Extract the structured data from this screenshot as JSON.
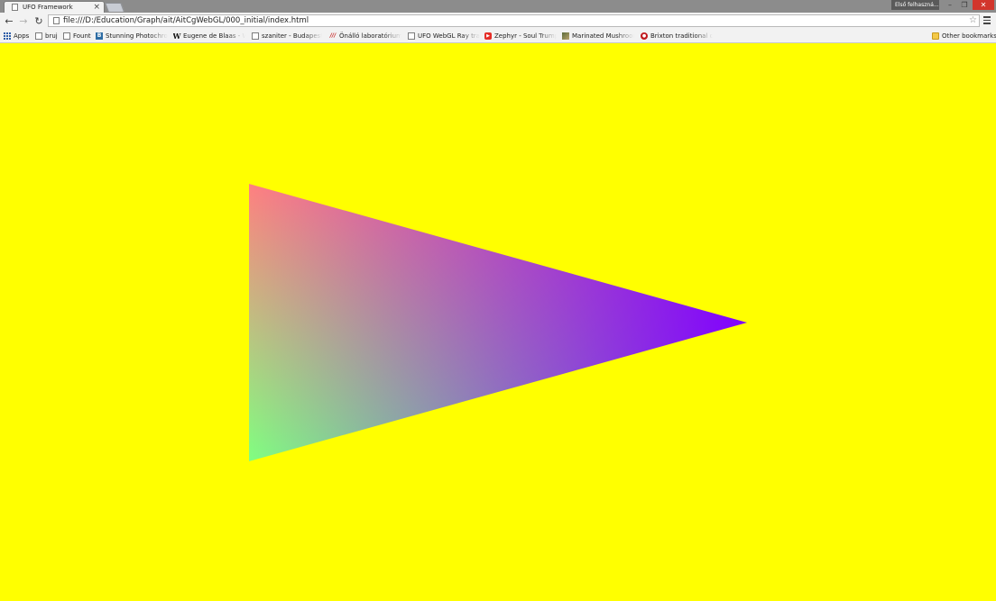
{
  "tab": {
    "title": "UFO Framework",
    "close_glyph": "×"
  },
  "window": {
    "profile_label": "Első felhaszná...",
    "minimize_glyph": "–",
    "maximize_glyph": "❐",
    "close_glyph": "✕"
  },
  "toolbar": {
    "back_glyph": "←",
    "forward_glyph": "→",
    "reload_glyph": "↻",
    "url": "file:///D:/Education/Graph/ait/AitCgWebGL/000_initial/index.html",
    "star_glyph": "☆"
  },
  "bookmarks": {
    "apps": "Apps",
    "items": [
      "bruj",
      "Fount",
      "Stunning Photochrom",
      "Eugene de Blaas - Wik",
      "szaniter - Budapest X",
      "Önálló laboratórium",
      "UFO WebGL Ray trac",
      "Zephyr - Soul Trumpe",
      "Marinated Mushroom",
      "Brixton traditional caf"
    ],
    "other": "Other bookmarks"
  },
  "scene": {
    "background_color": "#ffff00",
    "vertex_colors": {
      "top_left": "#ff8080",
      "bottom_left": "#80ff80",
      "right": "#8000ff"
    }
  }
}
